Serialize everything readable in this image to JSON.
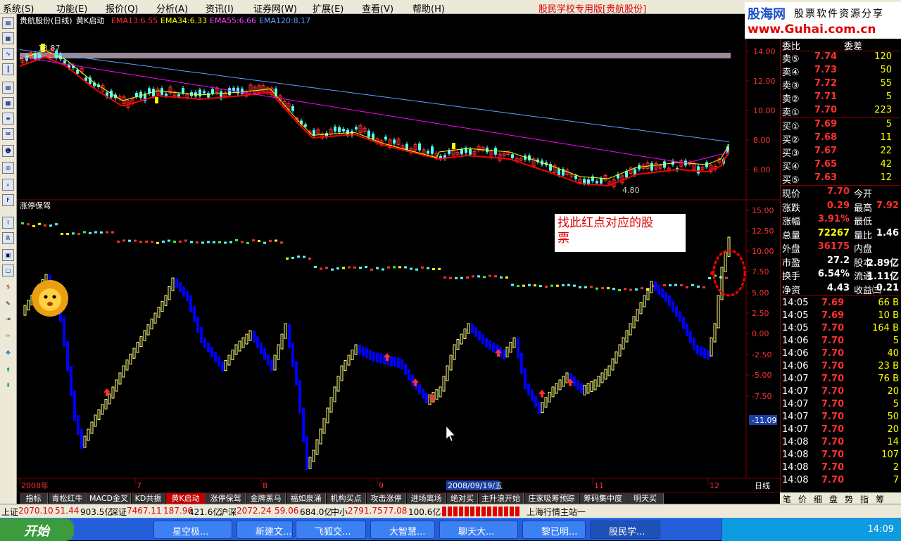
{
  "menu": {
    "items": [
      "系统(S)",
      "功能(E)",
      "报价(Q)",
      "分析(A)",
      "资讯(I)",
      "证券网(W)",
      "扩展(E)",
      "查看(V)",
      "帮助(H)"
    ],
    "title": "股民学校专用版[贵航股份]"
  },
  "logo": {
    "line1a": "股海网",
    "line1b": "股票软件资源分享",
    "line2": "www.Guhai.com.cn"
  },
  "chart": {
    "header": {
      "name": "贵航股份(日线)",
      "indicator": "黄K启动",
      "ema13": "EMA13:6.55",
      "ema34": "EMA34:6.33",
      "ema55": "EMA55:6.66",
      "ema120": "EMA120:8.17"
    },
    "price_axis": [
      "14.00",
      "12.00",
      "10.00",
      "8.00",
      "6.00"
    ],
    "high_label": "13.87",
    "low_label": "4.80",
    "lower_title": "涨停保驾",
    "lower_axis": [
      "15.00",
      "12.50",
      "10.00",
      "7.50",
      "5.00",
      "2.50",
      "0.00",
      "-2.50",
      "-5.00",
      "-7.50"
    ],
    "lower_min": "-11.09",
    "annotation": "找此红点对应的股票",
    "date_axis": [
      "2008年",
      "7",
      "8",
      "9",
      "11",
      "12"
    ],
    "date_highlight": "2008/09/19/五",
    "period": "日线",
    "colors": {
      "up": "#ff3232",
      "down": "#54ffff",
      "ema13": "#ff0000",
      "ema34": "#ffff00",
      "ema55": "#ff00ff",
      "ema120": "#5aa0ff",
      "yellow_bar": "#ffff80",
      "blue_bar": "#0000ff"
    }
  },
  "quote": {
    "header": [
      "委比",
      "委差"
    ],
    "sell": [
      {
        "label": "卖⑤",
        "price": "7.74",
        "vol": "120"
      },
      {
        "label": "卖④",
        "price": "7.73",
        "vol": "50"
      },
      {
        "label": "卖③",
        "price": "7.72",
        "vol": "55"
      },
      {
        "label": "卖②",
        "price": "7.71",
        "vol": "5"
      },
      {
        "label": "卖①",
        "price": "7.70",
        "vol": "223"
      }
    ],
    "buy": [
      {
        "label": "买①",
        "price": "7.69",
        "vol": "5"
      },
      {
        "label": "买②",
        "price": "7.68",
        "vol": "11"
      },
      {
        "label": "买③",
        "price": "7.67",
        "vol": "22"
      },
      {
        "label": "买④",
        "price": "7.65",
        "vol": "42"
      },
      {
        "label": "买⑤",
        "price": "7.63",
        "vol": "12"
      }
    ],
    "stats": [
      {
        "l1": "现价",
        "v1": "7.70",
        "l2": "今开",
        "v2": ""
      },
      {
        "l1": "涨跌",
        "v1": "0.29",
        "l2": "最高",
        "v2": "7.92"
      },
      {
        "l1": "涨幅",
        "v1": "3.91%",
        "l2": "最低",
        "v2": ""
      },
      {
        "l1": "总量",
        "v1": "72267",
        "l2": "量比",
        "v2": "1.46"
      },
      {
        "l1": "外盘",
        "v1": "36175",
        "l2": "内盘",
        "v2": ""
      },
      {
        "l1": "市盈",
        "v1": "27.2",
        "l2": "股本",
        "v2": "2.89亿"
      },
      {
        "l1": "换手",
        "v1": "6.54%",
        "l2": "流通",
        "v2": "1.11亿"
      },
      {
        "l1": "净资",
        "v1": "4.43",
        "l2": "收益㈢",
        "v2": "0.21"
      }
    ],
    "ticks": [
      {
        "t": "14:05",
        "p": "7.69",
        "v": "66 B"
      },
      {
        "t": "14:05",
        "p": "7.69",
        "v": "10 B"
      },
      {
        "t": "14:05",
        "p": "7.70",
        "v": "164 B"
      },
      {
        "t": "14:06",
        "p": "7.70",
        "v": "5"
      },
      {
        "t": "14:06",
        "p": "7.70",
        "v": "40"
      },
      {
        "t": "14:06",
        "p": "7.70",
        "v": "23 B"
      },
      {
        "t": "14:07",
        "p": "7.70",
        "v": "76 B"
      },
      {
        "t": "14:07",
        "p": "7.70",
        "v": "20"
      },
      {
        "t": "14:07",
        "p": "7.70",
        "v": "5"
      },
      {
        "t": "14:07",
        "p": "7.70",
        "v": "50"
      },
      {
        "t": "14:07",
        "p": "7.70",
        "v": "20"
      },
      {
        "t": "14:08",
        "p": "7.70",
        "v": "14"
      },
      {
        "t": "14:08",
        "p": "7.70",
        "v": "107"
      },
      {
        "t": "14:08",
        "p": "7.70",
        "v": "2"
      },
      {
        "t": "14:08",
        "p": "7.70",
        "v": "7"
      }
    ]
  },
  "tabs": [
    "指标",
    "青松红牛",
    "MACD金叉",
    "KD共振",
    "黄K启动",
    "涨停保驾",
    "金牌黑马",
    "福如泉涌",
    "机构买点",
    "攻击涨停",
    "进场离场",
    "绝对买",
    "主升浪开始",
    "庄家吸筹预踪",
    "筹码集中度",
    "明天买"
  ],
  "active_tab": 4,
  "side_tabs": [
    "笔",
    "价",
    "细",
    "盘",
    "势",
    "指",
    "筹"
  ],
  "status": {
    "sh_label": "上证",
    "sh_val": "2070.10",
    "sh_chg": "51.44",
    "sh_amt": "903.5亿",
    "sz_label": "深证",
    "sz_val": "7467.11",
    "sz_chg": "187.96",
    "sz_amt": "421.6亿",
    "hs_label": "沪深",
    "hs_val": "2072.24",
    "hs_chg": "59.06",
    "hs_amt": "684.0亿",
    "zx_label": "中小",
    "zx_val": "2791.75",
    "zx_chg": "77.08",
    "zx_amt": "100.6亿",
    "site": "上海行情主站一"
  },
  "taskbar": {
    "start": "开始",
    "tasks": [
      "星空极...",
      "新建文...",
      "飞狐交...",
      "大智慧...",
      "聊天大...",
      "黎已明...",
      "股民学..."
    ],
    "clock": "14:09"
  }
}
